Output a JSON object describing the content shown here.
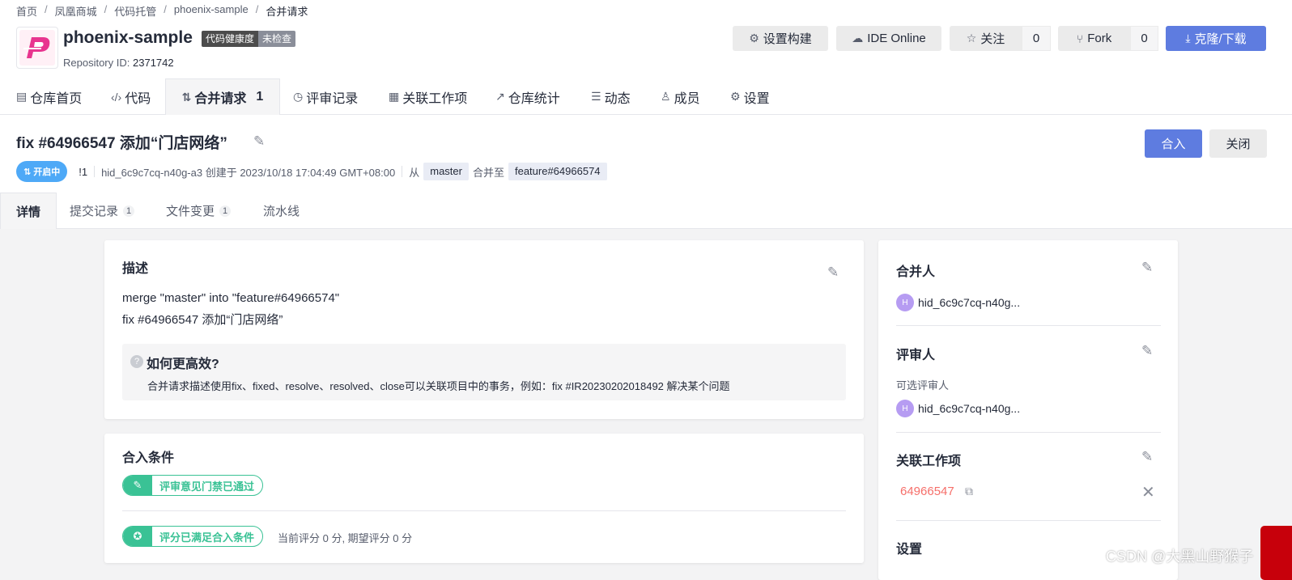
{
  "breadcrumb": [
    "首页",
    "凤凰商城",
    "代码托管",
    "phoenix-sample",
    "合并请求"
  ],
  "repo": {
    "name": "phoenix-sample",
    "health_label": "代码健康度",
    "health_status": "未检查",
    "id_label": "Repository ID:",
    "id_value": "2371742"
  },
  "header_buttons": {
    "settings_build": "设置构建",
    "ide_online": "IDE Online",
    "watch": "关注",
    "watch_count": "0",
    "fork": "Fork",
    "fork_count": "0",
    "clone": "克隆/下载"
  },
  "nav": [
    {
      "label": "仓库首页",
      "icon": "file-icon"
    },
    {
      "label": "代码",
      "icon": "code-icon"
    },
    {
      "label": "合并请求",
      "icon": "merge-icon",
      "count": "1"
    },
    {
      "label": "评审记录",
      "icon": "review-icon"
    },
    {
      "label": "关联工作项",
      "icon": "workitem-icon"
    },
    {
      "label": "仓库统计",
      "icon": "stats-icon"
    },
    {
      "label": "动态",
      "icon": "list-icon"
    },
    {
      "label": "成员",
      "icon": "user-icon"
    },
    {
      "label": "设置",
      "icon": "gear-icon"
    }
  ],
  "mr": {
    "title": "fix #64966547 添加“门店网络”",
    "status": "开启中",
    "number": "!1",
    "created": "hid_6c9c7cq-n40g-a3 创建于 2023/10/18 17:04:49 GMT+08:00",
    "from_label": "从",
    "source_branch": "master",
    "to_label": "合并至",
    "target_branch": "feature#64966574",
    "merge_button": "合入",
    "close_button": "关闭"
  },
  "subtabs": [
    {
      "label": "详情"
    },
    {
      "label": "提交记录",
      "count": "1"
    },
    {
      "label": "文件变更",
      "count": "1"
    },
    {
      "label": "流水线"
    }
  ],
  "description": {
    "title": "描述",
    "lines": [
      "merge \"master\" into \"feature#64966574\"",
      "fix #64966547 添加“门店网络”"
    ],
    "tip_title": "如何更高效?",
    "tip_text": "合并请求描述使用fix、fixed、resolve、resolved、close可以关联项目中的事务，例如：fix #IR20230202018492 解决某个问题"
  },
  "conditions": {
    "title": "合入条件",
    "review_gate": "评审意见门禁已通过",
    "score_gate": "评分已满足合入条件",
    "score_text": "当前评分 0 分, 期望评分 0 分"
  },
  "sidebar": {
    "merger_title": "合并人",
    "merger_avatar": "H",
    "merger_name": "hid_6c9c7cq-n40g...",
    "reviewer_title": "评审人",
    "reviewer_hint": "可选评审人",
    "reviewer_avatar": "H",
    "reviewer_name": "hid_6c9c7cq-n40g...",
    "workitem_title": "关联工作项",
    "workitem_id": "64966547",
    "settings_title": "设置"
  },
  "watermark": "CSDN @大黑山野猴子",
  "colors": {
    "primary": "#5e7ce0",
    "success": "#3ac295",
    "status_open": "#4ea9f7",
    "workitem": "#f66f6a"
  }
}
